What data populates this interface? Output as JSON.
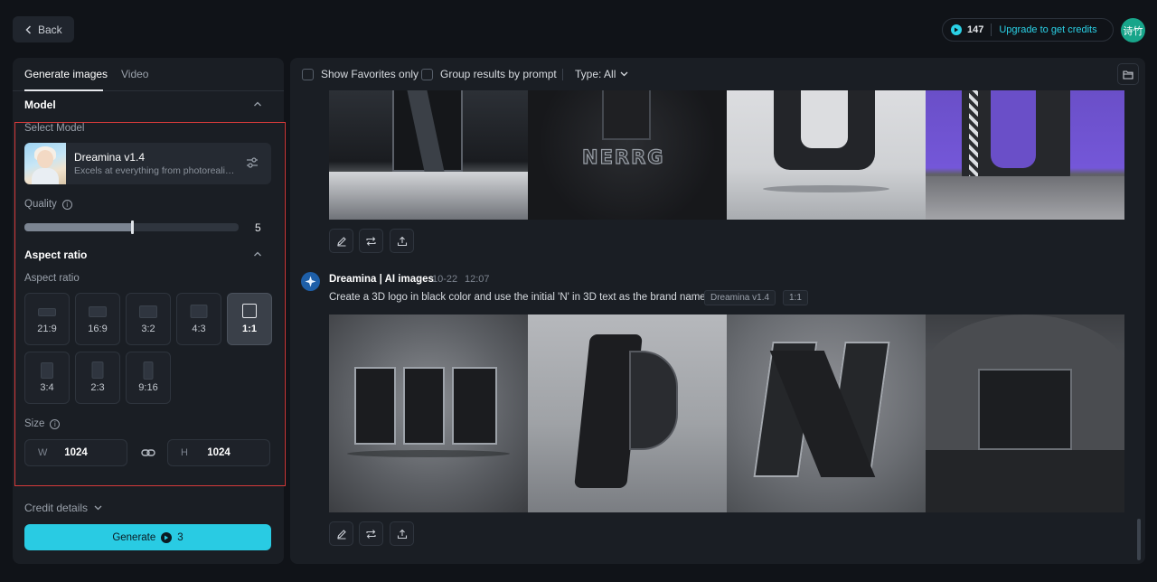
{
  "topbar": {
    "back_label": "Back",
    "credits_count": "147",
    "upgrade_label": "Upgrade to get credits",
    "avatar_text": "诗竹",
    "accent_color": "#2ad1e6"
  },
  "left": {
    "tabs": [
      {
        "label": "Generate images",
        "active": true
      },
      {
        "label": "Video",
        "active": false
      }
    ],
    "model_section_title": "Model",
    "select_model_label": "Select Model",
    "model": {
      "name": "Dreamina v1.4",
      "description": "Excels at everything from photorealism to painterly style"
    },
    "quality_label": "Quality",
    "quality_value": "5",
    "quality_fraction": 0.5,
    "aspect_section_title": "Aspect ratio",
    "aspect_label": "Aspect ratio",
    "ratios": [
      "21:9",
      "16:9",
      "3:2",
      "4:3",
      "1:1",
      "3:4",
      "2:3",
      "9:16"
    ],
    "selected_ratio": "1:1",
    "size_label": "Size",
    "width_key": "W",
    "width_value": "1024",
    "height_key": "H",
    "height_value": "1024",
    "credit_details_label": "Credit details",
    "generate_label": "Generate",
    "generate_cost": "3"
  },
  "right": {
    "show_favorites_label": "Show Favorites only",
    "group_results_label": "Group results by prompt",
    "type_label": "Type: All",
    "result": {
      "author": "Dreamina | AI images",
      "date": "10-22",
      "time": "12:07",
      "prompt": "Create a 3D logo in black color and use the initial 'N' in 3D text as the brand name",
      "tag_model": "Dreamina v1.4",
      "tag_ratio": "1:1"
    },
    "previous_images": [
      "nerrg-text"
    ],
    "nerrg_text": "NERRG"
  }
}
